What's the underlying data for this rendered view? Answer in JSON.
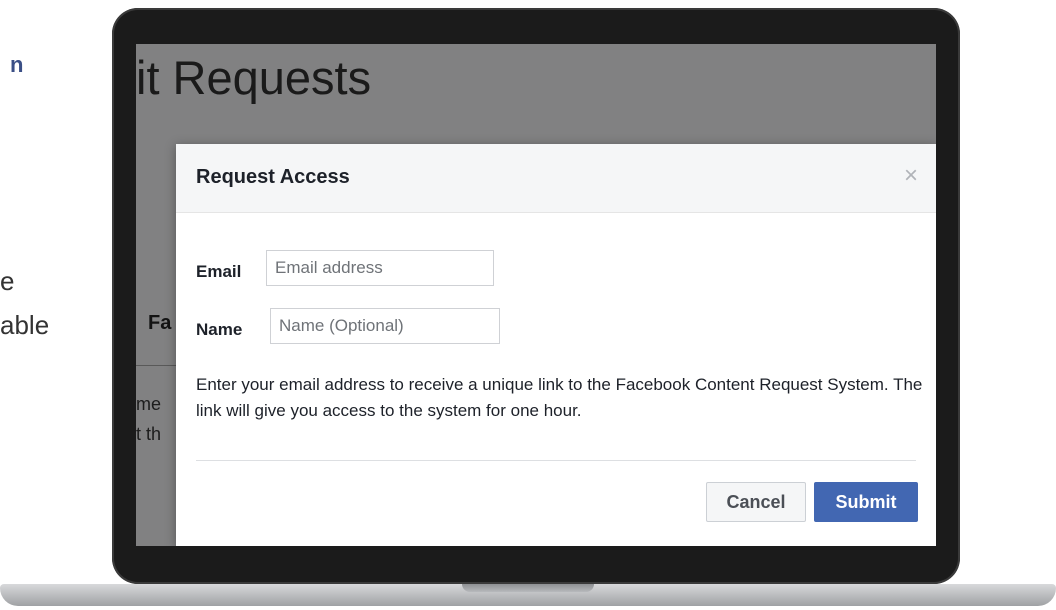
{
  "slide": {
    "text_n": "n",
    "text_e": "e",
    "text_able": "able"
  },
  "background_page": {
    "title_fragment": "it Requests",
    "fa_fragment": "Fa",
    "line1_fragment": "me",
    "line2_fragment": "t th"
  },
  "modal": {
    "title": "Request Access",
    "close_icon": "×",
    "email": {
      "label": "Email",
      "value": "",
      "placeholder": "Email address"
    },
    "name": {
      "label": "Name",
      "value": "",
      "placeholder": "Name (Optional)"
    },
    "description": "Enter your email address to receive a unique link to the Facebook Content Request System. The link will give you access to the system for one hour.",
    "cancel_label": "Cancel",
    "submit_label": "Submit"
  },
  "colors": {
    "primary_button": "#4267b2",
    "header_bg": "#f5f6f7",
    "overlay": "rgba(0,0,0,0.42)",
    "slide_accent": "#3b4f86"
  }
}
